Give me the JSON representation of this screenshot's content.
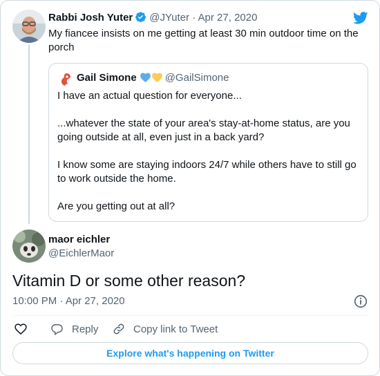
{
  "colors": {
    "accent": "#1d9bf0",
    "text": "#0f1419",
    "muted": "#536471",
    "border": "#cfd9de"
  },
  "icons": [
    "twitter-bird-icon",
    "verified-badge-icon",
    "blue-heart-icon",
    "yellow-heart-icon",
    "info-icon",
    "heart-icon",
    "reply-icon",
    "link-icon"
  ],
  "reply_tweet": {
    "author_name": "Rabbi Josh Yuter",
    "handle": "@JYuter",
    "date": "Apr 27, 2020",
    "text": "My fiancee insists on me getting at least 30 min outdoor time on the porch"
  },
  "quoted_tweet": {
    "author_name": "Gail Simone",
    "handle": "@GailSimone",
    "paragraphs": [
      "I have an actual question for everyone...",
      "...whatever the state of your area's stay-at-home status, are you going outside at all, even just in a back yard?",
      "I know some are staying indoors 24/7 while others have to still go to work outside the home.",
      "Are you getting out at all?"
    ]
  },
  "main_tweet": {
    "author_name": "maor eichler",
    "handle": "@EichlerMaor",
    "text": "Vitamin D or some other reason?",
    "timestamp": "10:00 PM · Apr 27, 2020"
  },
  "actions": {
    "reply_label": "Reply",
    "copy_link_label": "Copy link to Tweet"
  },
  "explore_label": "Explore what's happening on Twitter"
}
